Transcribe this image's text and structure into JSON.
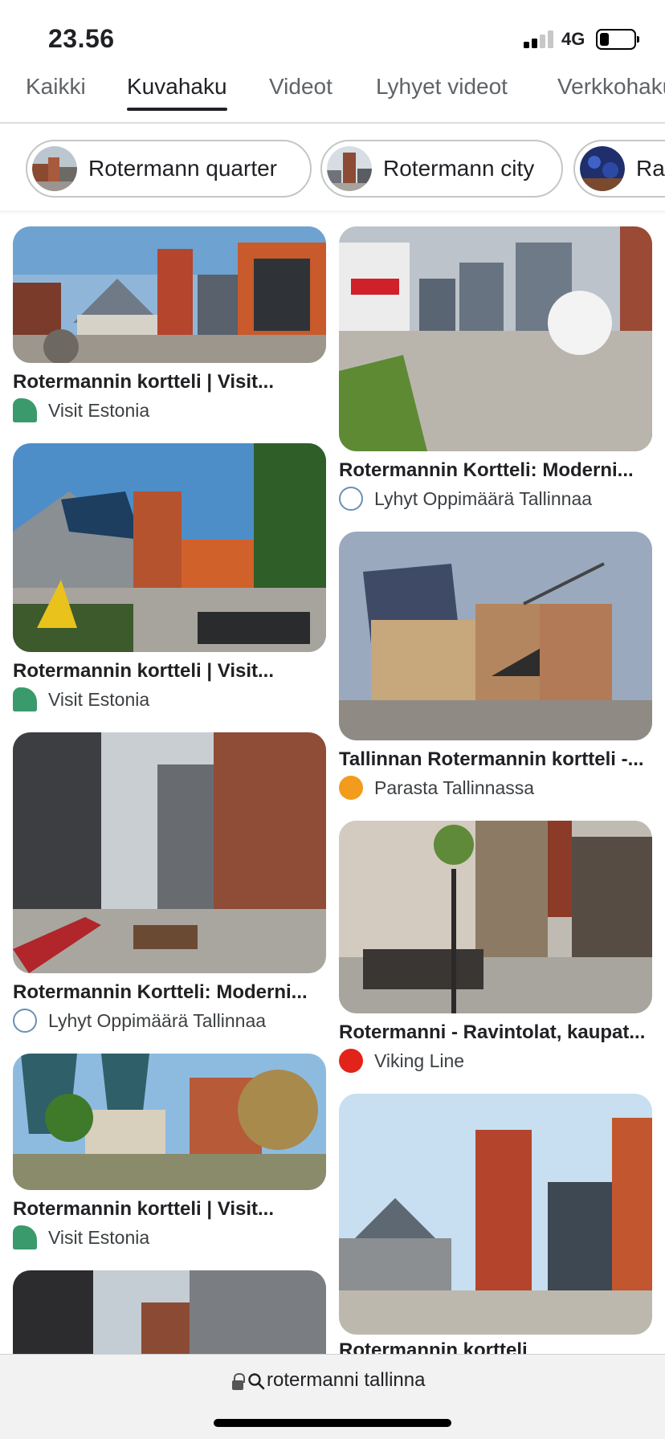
{
  "status_bar": {
    "time": "23.56",
    "network": "4G"
  },
  "tabs": [
    {
      "label": "Kaikki",
      "active": false
    },
    {
      "label": "Kuvahaku",
      "active": true
    },
    {
      "label": "Videot",
      "active": false
    },
    {
      "label": "Lyhyet videot",
      "active": false
    },
    {
      "label": "Verkkohaku",
      "active": false
    }
  ],
  "chips": [
    {
      "label": "Rotermann quarter"
    },
    {
      "label": "Rotermann city"
    },
    {
      "label": "Ravintolat"
    }
  ],
  "results": {
    "left": [
      {
        "title": "Rotermannin kortteli | Visit...",
        "source": "Visit Estonia"
      },
      {
        "title": "Rotermannin kortteli | Visit...",
        "source": "Visit Estonia"
      },
      {
        "title": "Rotermannin Kortteli: Moderni...",
        "source": "Lyhyt Oppimäärä Tallinnaa"
      },
      {
        "title": "Rotermannin kortteli | Visit...",
        "source": "Visit Estonia"
      },
      {
        "title": "",
        "source": ""
      }
    ],
    "right": [
      {
        "title": "Rotermannin Kortteli: Moderni...",
        "source": "Lyhyt Oppimäärä Tallinnaa"
      },
      {
        "title": "Tallinnan Rotermannin kortteli -...",
        "source": "Parasta Tallinnassa"
      },
      {
        "title": "Rotermanni - Ravintolat, kaupat...",
        "source": "Viking Line"
      },
      {
        "title": "Rotermannin kortteli",
        "source": ""
      }
    ]
  },
  "urlbar": {
    "query": "rotermanni tallinna"
  },
  "colors": {
    "active_tab": "#202124",
    "inactive_tab": "#5f6368",
    "visit_estonia_favicon": "#3a9a6b",
    "parasta_favicon": "#f29b1d",
    "viking_favicon": "#e2231a"
  }
}
